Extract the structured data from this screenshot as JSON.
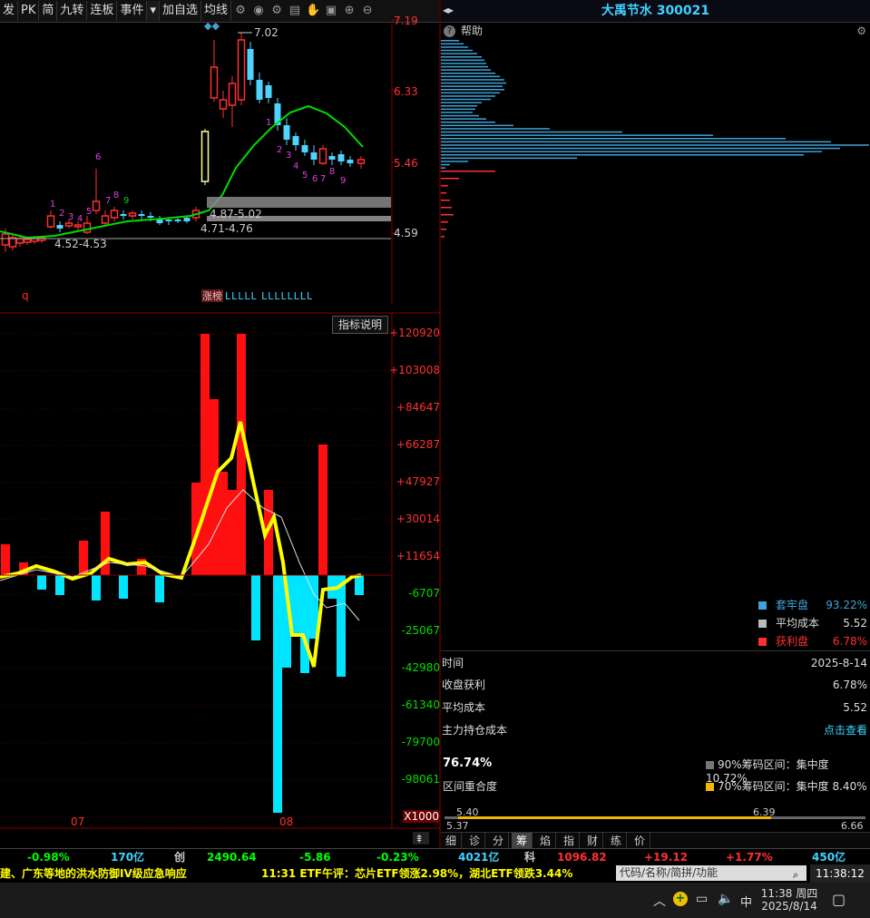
{
  "toolbar": {
    "items": [
      "发",
      "PK",
      "简",
      "九转",
      "连板",
      "事件",
      "▾",
      "加自选",
      "均线",
      "█"
    ],
    "icons": [
      "settings-icon",
      "eye-icon",
      "settings-icon",
      "store-icon",
      "hand-icon",
      "bag-icon",
      "zoom-in-icon",
      "zoom-out-icon"
    ]
  },
  "stock": {
    "name": "大禹节水",
    "code": "300021",
    "title": "大禹节水 300021"
  },
  "price_axis": [
    "7.19",
    "6.33",
    "5.46",
    "4.59"
  ],
  "indicator_axis": [
    "+120920",
    "+103008",
    "+84647",
    "+66287",
    "+47927",
    "+30014",
    "+11654",
    "-6707",
    "-25067",
    "-42980",
    "-61340",
    "-79700",
    "-98061",
    "X1000"
  ],
  "annotations": {
    "high_price": "7.02",
    "range1": "4.87-5.02",
    "range2": "4.71-4.76",
    "range3": "4.52-4.53",
    "q_label": "q",
    "zhangting": "涨榜",
    "l_marks": "LLLLL  LLLLLLLL",
    "indicator_button": "指标说明",
    "month1": "07",
    "month2": "08",
    "seq_before": [
      "1",
      "2",
      "3",
      "4",
      "5",
      "6",
      "7",
      "8",
      "9"
    ],
    "seq_after": [
      "1",
      "2",
      "3",
      "4",
      "5",
      "6",
      "7",
      "8",
      "9"
    ]
  },
  "right": {
    "help": "帮助",
    "legend": [
      {
        "label": "套牢盘",
        "value": "93.22%",
        "color": "#3fa3d8"
      },
      {
        "label": "平均成本",
        "value": "5.52",
        "color": "#bbbbbb"
      },
      {
        "label": "获利盘",
        "value": "6.78%",
        "color": "#ff3030"
      }
    ],
    "info": [
      {
        "label": "时间",
        "value": "2025-8-14"
      },
      {
        "label": "收盘获利",
        "value": "6.78%"
      },
      {
        "label": "平均成本",
        "value": "5.52"
      },
      {
        "label": "主力持仓成本",
        "value": "点击查看"
      }
    ],
    "overlap_pct": "76.74%",
    "overlap_label": "区间重合度",
    "range90": "90%筹码区间：集中度10.72%",
    "range70": "70%筹码区间：集中度 8.40%",
    "bar_left_top": "5.40",
    "bar_right_top": "6.39",
    "bar_left_bottom": "5.37",
    "bar_right_bottom": "6.66",
    "tabs": [
      "细",
      "诊",
      "分",
      "筹",
      "焰",
      "指",
      "财",
      "练",
      "价"
    ]
  },
  "ticker": {
    "items": [
      {
        "text": "-0.98%",
        "color": "#00ff00"
      },
      {
        "text": "170亿",
        "color": "#3fd3ff"
      },
      {
        "text": "创",
        "color": "#cccccc"
      },
      {
        "text": "2490.64",
        "color": "#00ff00"
      },
      {
        "text": "-5.86",
        "color": "#00ff00"
      },
      {
        "text": "-0.23%",
        "color": "#00ff00"
      },
      {
        "text": "4021亿",
        "color": "#3fd3ff"
      },
      {
        "text": "科",
        "color": "#cccccc"
      },
      {
        "text": "1096.82",
        "color": "#ff3030"
      },
      {
        "text": "+19.12",
        "color": "#ff3030"
      },
      {
        "text": "+1.77%",
        "color": "#ff3030"
      },
      {
        "text": "450亿",
        "color": "#3fd3ff"
      }
    ]
  },
  "news": {
    "text1": "建、广东等地的洪水防御IV级应急响应",
    "text2": "11:31 ETF午评：芯片ETF领涨2.98%，湖北ETF领跌3.44%",
    "search_placeholder": "代码/名称/简拼/功能",
    "clock": "11:38:12"
  },
  "taskbar": {
    "time": "11:38 周四",
    "date": "2025/8/14",
    "ime": "中"
  }
}
